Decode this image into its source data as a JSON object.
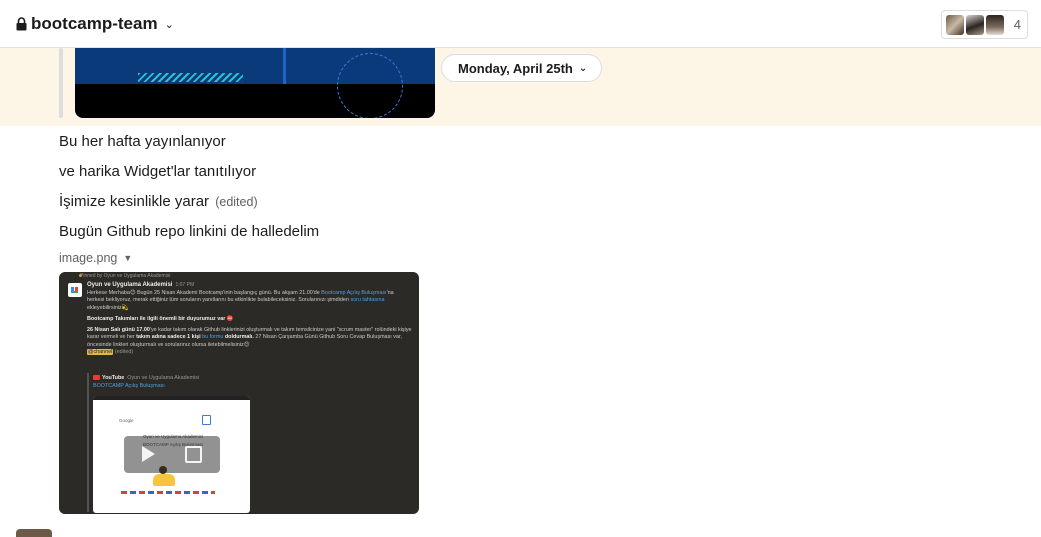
{
  "header": {
    "channel_name": "bootcamp-team",
    "member_count": "4",
    "icons": [
      "lock-icon",
      "chevron-down-icon"
    ]
  },
  "date_divider": {
    "label": "Monday, April 25th"
  },
  "messages": [
    {
      "text": "Bu her hafta yayınlanıyor"
    },
    {
      "text": "ve harika Widget'lar tanıtılıyor"
    },
    {
      "text": "İşimize kesinlikle yarar",
      "edited": "(edited)"
    },
    {
      "text": "Bugün Github repo linkini de halledelim"
    }
  ],
  "attachment": {
    "file_name": "image.png",
    "screenshot": {
      "pinned": "Pinned by Oyun ve Uygulama Akademisi",
      "author": "Oyun ve Uygulama Akademisi",
      "time": "1:07 PM",
      "p1_a": "Herkese Merhaba😊 Bugün 25 Nisan Akademi Bootcamp'inin başlangıç günü. Bu akşam 21.00'de ",
      "p1_link": "Bootcamp Açılış Buluşması",
      "p1_b": "'na herkesi bekliyoruz, merak ettiğiniz tüm soruların yanıtlarını bu etkinlikte bulabileceksiniz. Sorularınızı şimdiden ",
      "p1_link2": "soru tahtasına",
      "p1_c": " ekleyebilirsiniz💫",
      "p2": "Bootcamp Takımları ile ilgili önemli bir duyurumuz var ⛔",
      "p3_bold": "26 Nisan Salı günü 17.00",
      "p3_a": "'ye kadar takım olarak Github linklerinizi oluşturmalı ve takım temsilcinize yani \"scrum master\" rolündeki kişiye karar vermeli ve her ",
      "p3_bold2": "takım adına sadece 1 kişi",
      "p3_link": "bu formu",
      "p3_bold3": "doldurmalı.",
      "p3_b": " 27 Nisan Çarşamba Günü Github Soru Cevap Buluşması var, öncesinde linkleri oluşturmalı ve sorularınız olursa iletebilmelisiniz😊",
      "channel_tag": "@channel",
      "channel_edited": "(edited)",
      "yt_source": "YouTube",
      "yt_channel": "Oyun ve Uygulama Akademisi",
      "yt_title": "BOOTCAMP Açılış Buluşması",
      "thumb_brand": "Google",
      "thumb_text1": "Oyun ve Uygulama Akademisi",
      "thumb_text2": "BOOTCAMP Açılış Buluşması"
    }
  }
}
